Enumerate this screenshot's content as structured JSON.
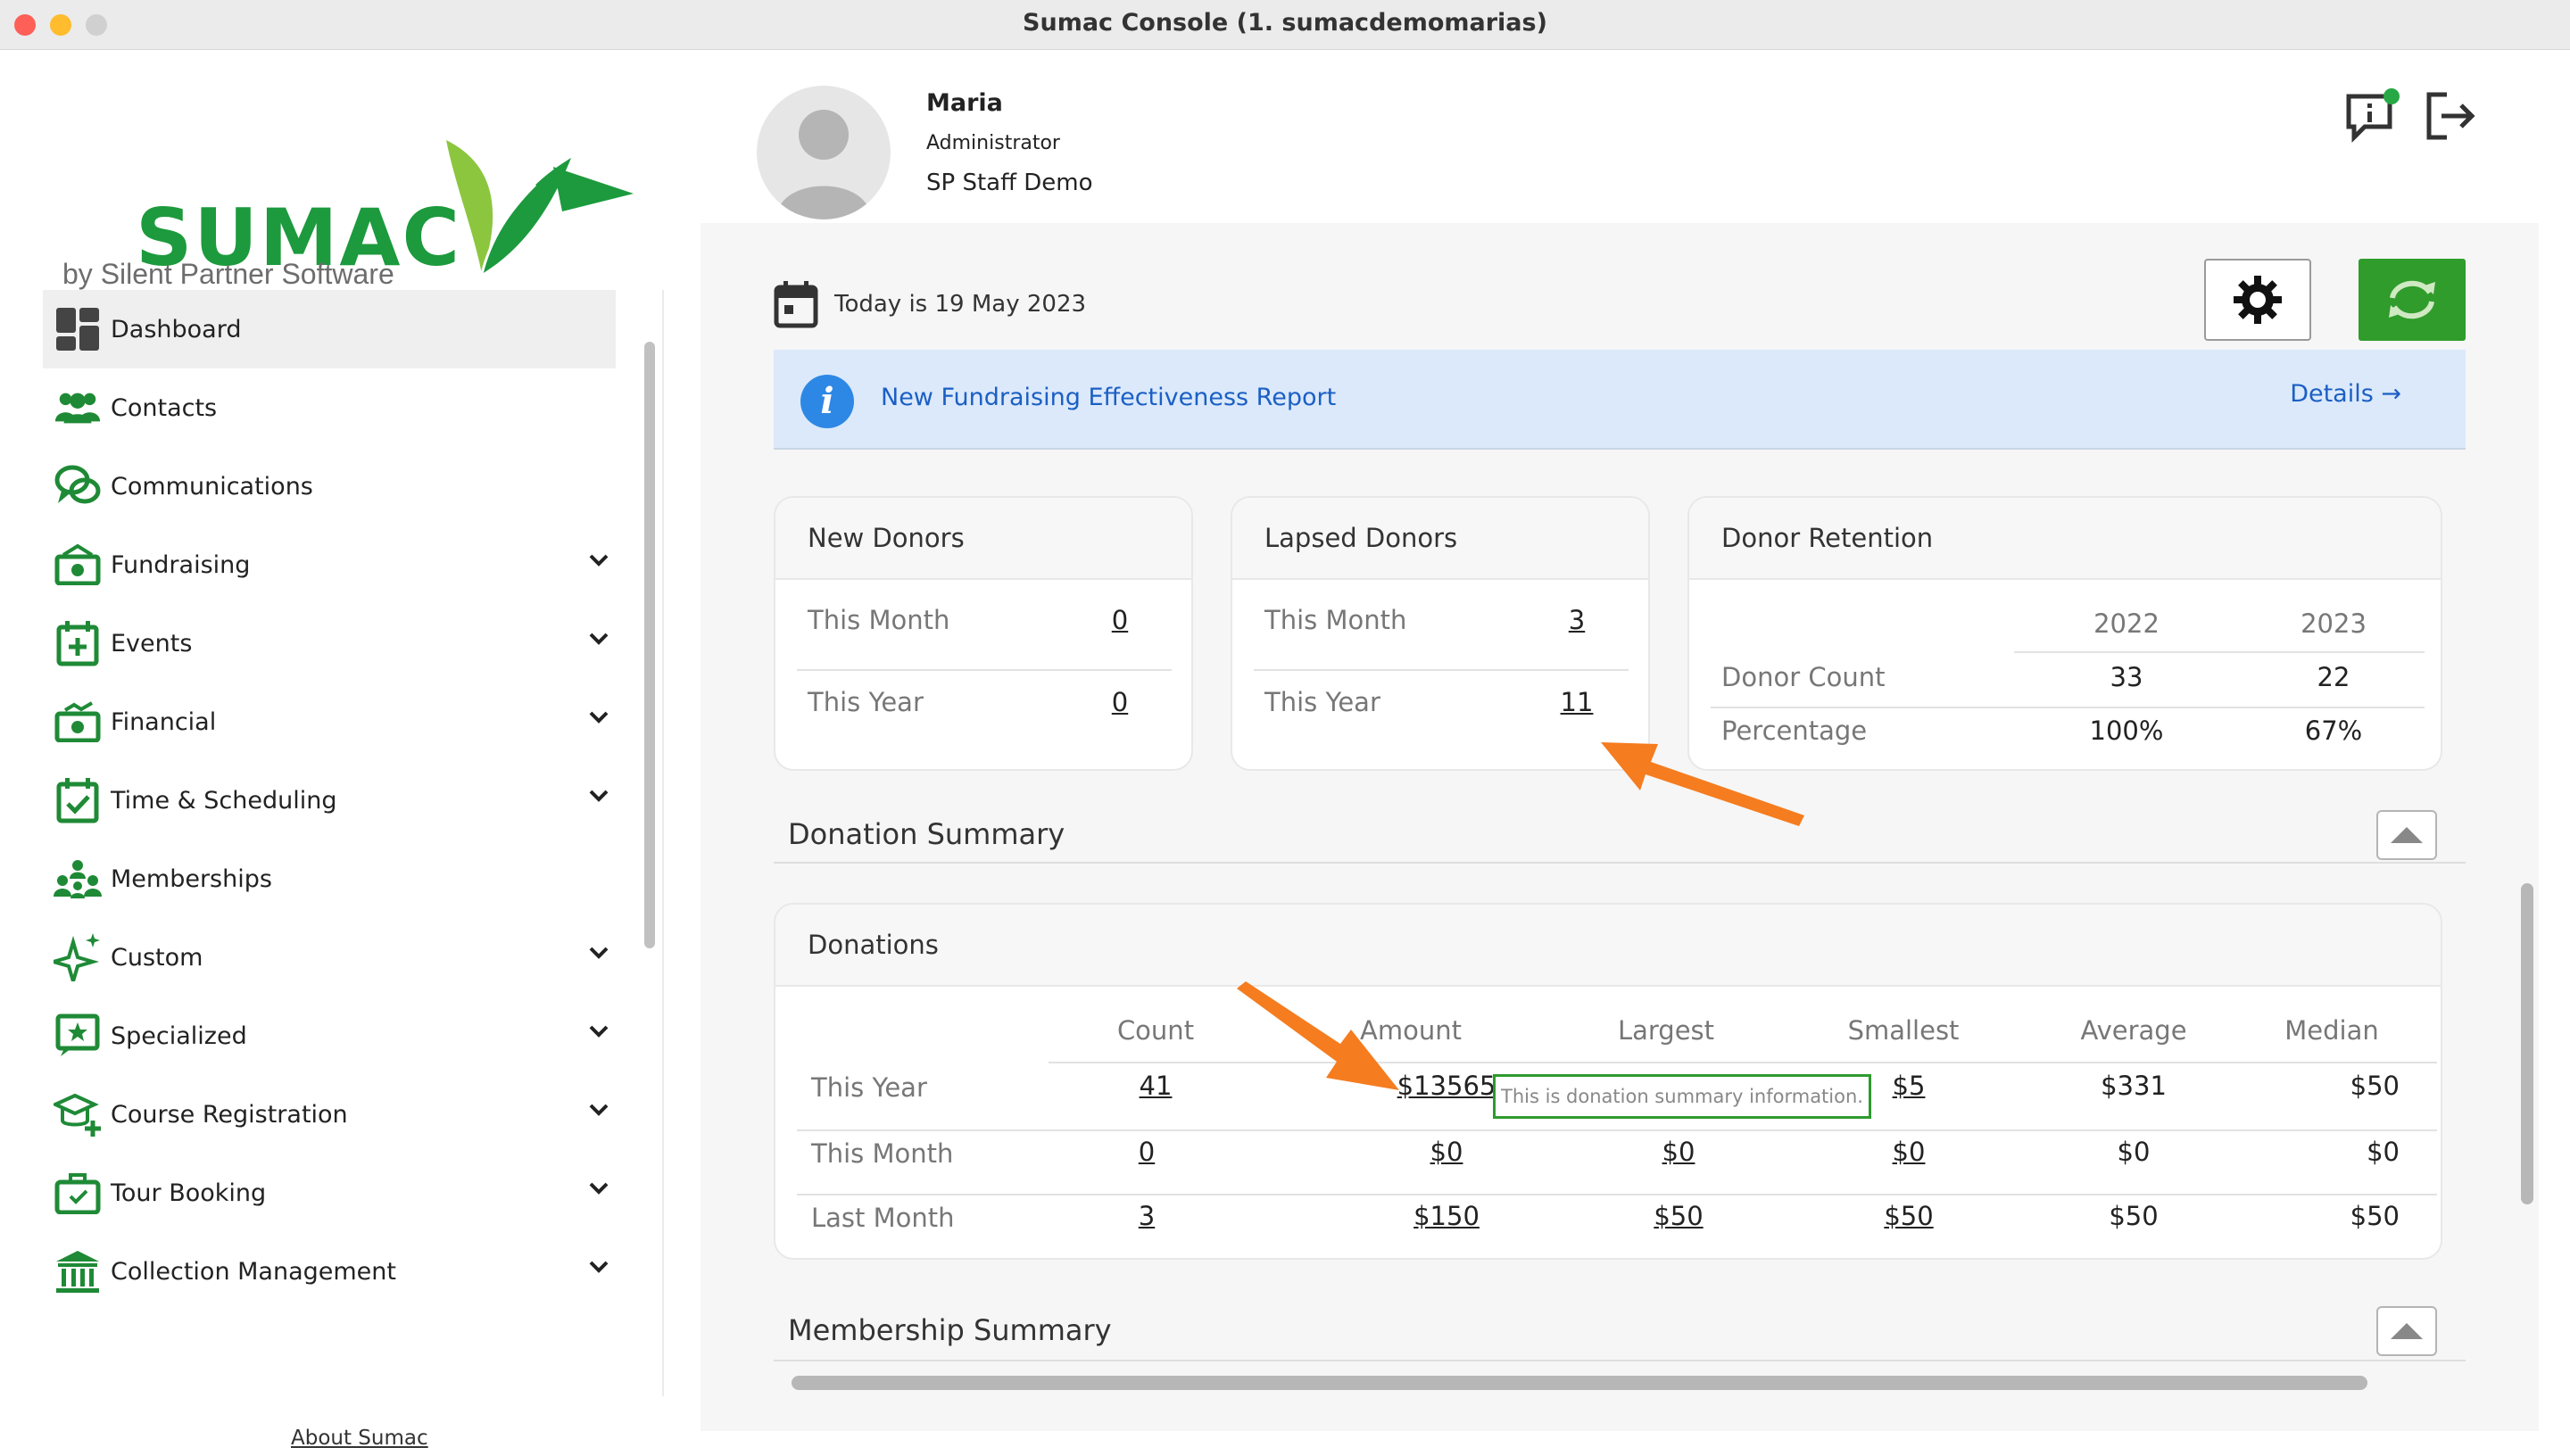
{
  "window": {
    "title": "Sumac Console (1. sumacdemomarias)"
  },
  "logo": {
    "main": "SUMAC",
    "sub": "by Silent Partner Software"
  },
  "sidebar": {
    "items": [
      {
        "label": "Dashboard",
        "icon": "dashboard-icon",
        "active": true,
        "expandable": false
      },
      {
        "label": "Contacts",
        "icon": "contacts-icon",
        "expandable": false
      },
      {
        "label": "Communications",
        "icon": "communications-icon",
        "expandable": false
      },
      {
        "label": "Fundraising",
        "icon": "fundraising-icon",
        "expandable": true
      },
      {
        "label": "Events",
        "icon": "events-icon",
        "expandable": true
      },
      {
        "label": "Financial",
        "icon": "financial-icon",
        "expandable": true
      },
      {
        "label": "Time & Scheduling",
        "icon": "time-scheduling-icon",
        "expandable": true
      },
      {
        "label": "Memberships",
        "icon": "memberships-icon",
        "expandable": false
      },
      {
        "label": "Custom",
        "icon": "custom-icon",
        "expandable": true
      },
      {
        "label": "Specialized",
        "icon": "specialized-icon",
        "expandable": true
      },
      {
        "label": "Course Registration",
        "icon": "course-registration-icon",
        "expandable": true
      },
      {
        "label": "Tour Booking",
        "icon": "tour-booking-icon",
        "expandable": true
      },
      {
        "label": "Collection Management",
        "icon": "collection-management-icon",
        "expandable": true
      }
    ],
    "about": "About Sumac"
  },
  "user": {
    "name": "Maria",
    "role": "Administrator",
    "org": "SP Staff Demo"
  },
  "header": {
    "date": "Today is 19 May 2023"
  },
  "banner": {
    "text": "New Fundraising Effectiveness Report",
    "link": "Details →"
  },
  "new_donors": {
    "title": "New Donors",
    "this_month_label": "This Month",
    "this_month": "0",
    "this_year_label": "This Year",
    "this_year": "0"
  },
  "lapsed_donors": {
    "title": "Lapsed Donors",
    "this_month_label": "This Month",
    "this_month": "3",
    "this_year_label": "This Year",
    "this_year": "11"
  },
  "retention": {
    "title": "Donor Retention",
    "years": [
      "2022",
      "2023"
    ],
    "rows": [
      {
        "label": "Donor Count",
        "values": [
          "33",
          "22"
        ]
      },
      {
        "label": "Percentage",
        "values": [
          "100%",
          "67%"
        ]
      }
    ]
  },
  "donation_summary": {
    "title": "Donation Summary"
  },
  "donations": {
    "title": "Donations",
    "columns": [
      "Count",
      "Amount",
      "Largest",
      "Smallest",
      "Average",
      "Median"
    ],
    "rows": [
      {
        "label": "This Year",
        "values": [
          "41",
          "$13565",
          "",
          "$5",
          "$331",
          "$50"
        ]
      },
      {
        "label": "This Month",
        "values": [
          "0",
          "$0",
          "$0",
          "$0",
          "$0",
          "$0"
        ]
      },
      {
        "label": "Last Month",
        "values": [
          "3",
          "$150",
          "$50",
          "$50",
          "$50",
          "$50"
        ]
      }
    ],
    "tooltip": "This is donation summary information."
  },
  "membership_summary": {
    "title": "Membership Summary"
  },
  "colors": {
    "brand": "#1c9a3d",
    "refresh": "#2f9c2b",
    "banner_bg": "#dbe9fb",
    "link_blue": "#1b5fc4",
    "annotation_arrow": "#f57c1f"
  }
}
